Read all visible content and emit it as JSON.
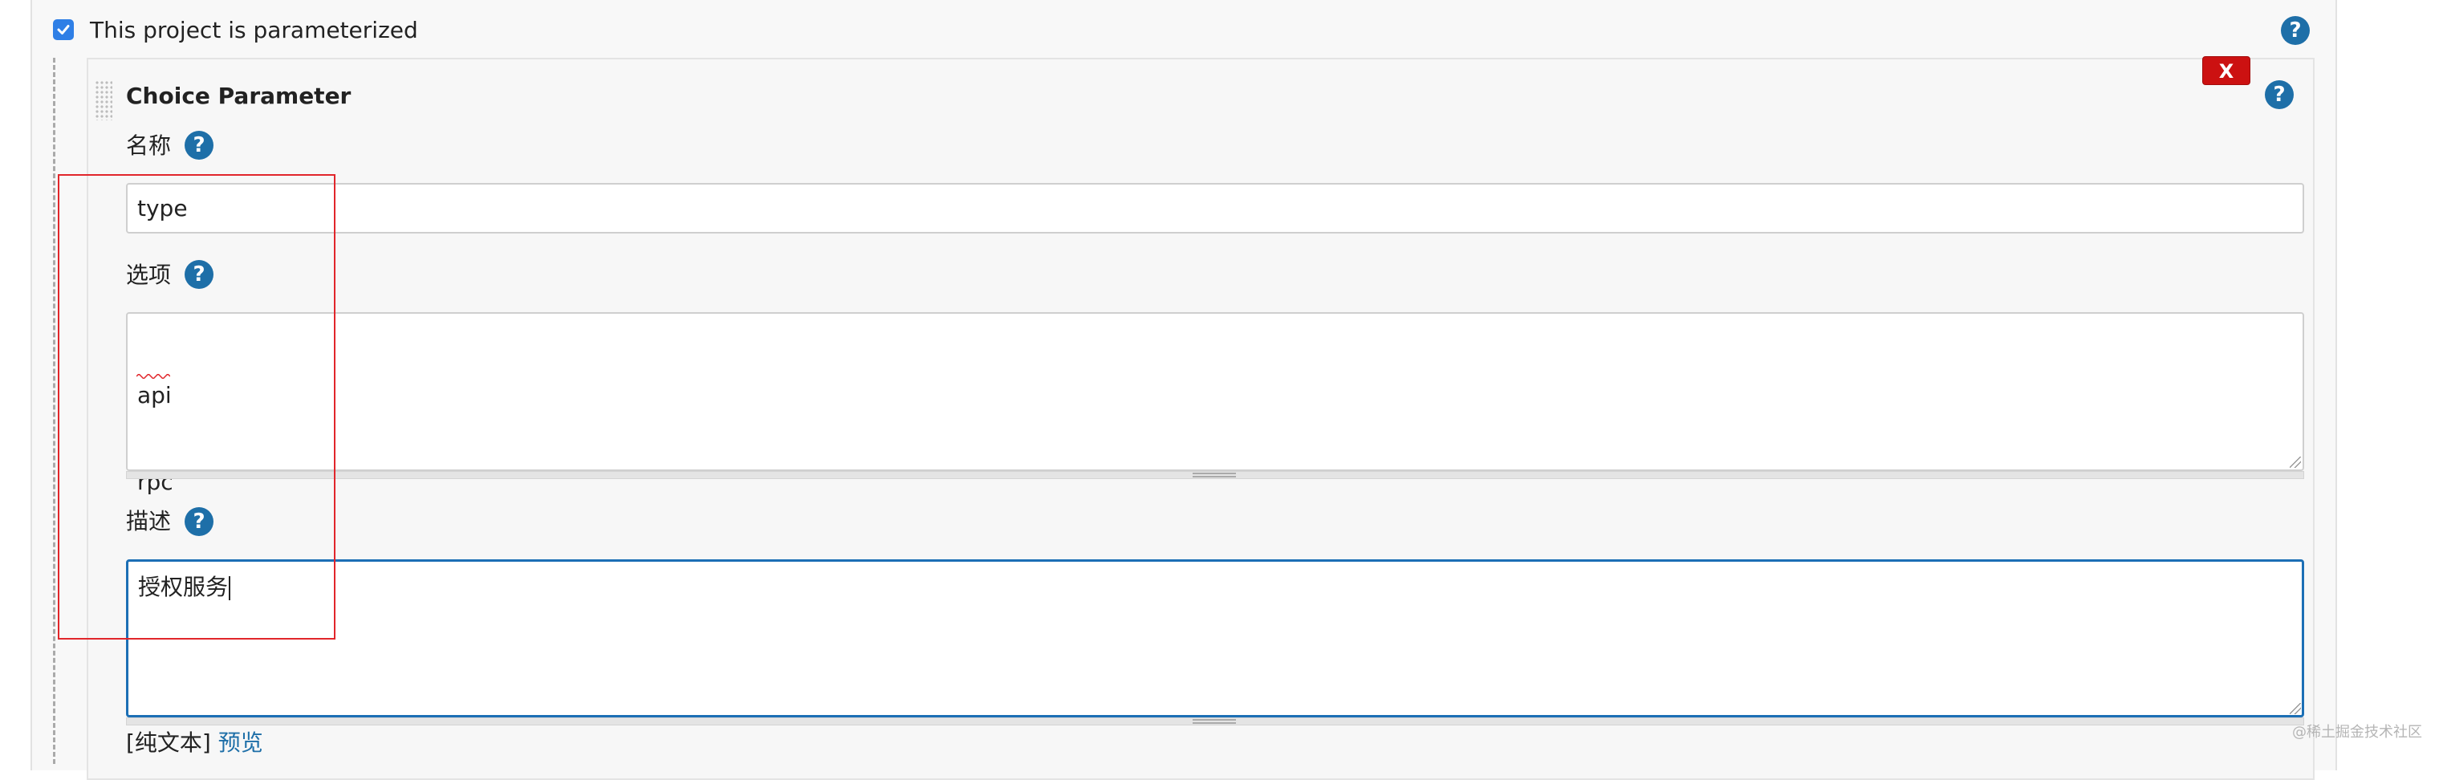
{
  "parameterized": {
    "label": "This project is parameterized",
    "checked": true
  },
  "parameter": {
    "title": "Choice Parameter",
    "delete_label": "X",
    "fields": {
      "name": {
        "label": "名称",
        "value": "type"
      },
      "choices": {
        "label": "选项",
        "lines": [
          "api",
          "rpc"
        ]
      },
      "description": {
        "label": "描述",
        "value": "授权服务"
      }
    }
  },
  "footer": {
    "plain_text": "[纯文本]",
    "preview": "预览"
  },
  "help": {
    "symbol": "?"
  },
  "watermark": "@稀土掘金技术社区",
  "colors": {
    "accent": "#1e6fa8",
    "checkbox": "#2f7fe6",
    "delete": "#cc1111",
    "highlight_box": "#e1262b",
    "focus_border": "#1c6fb5"
  }
}
